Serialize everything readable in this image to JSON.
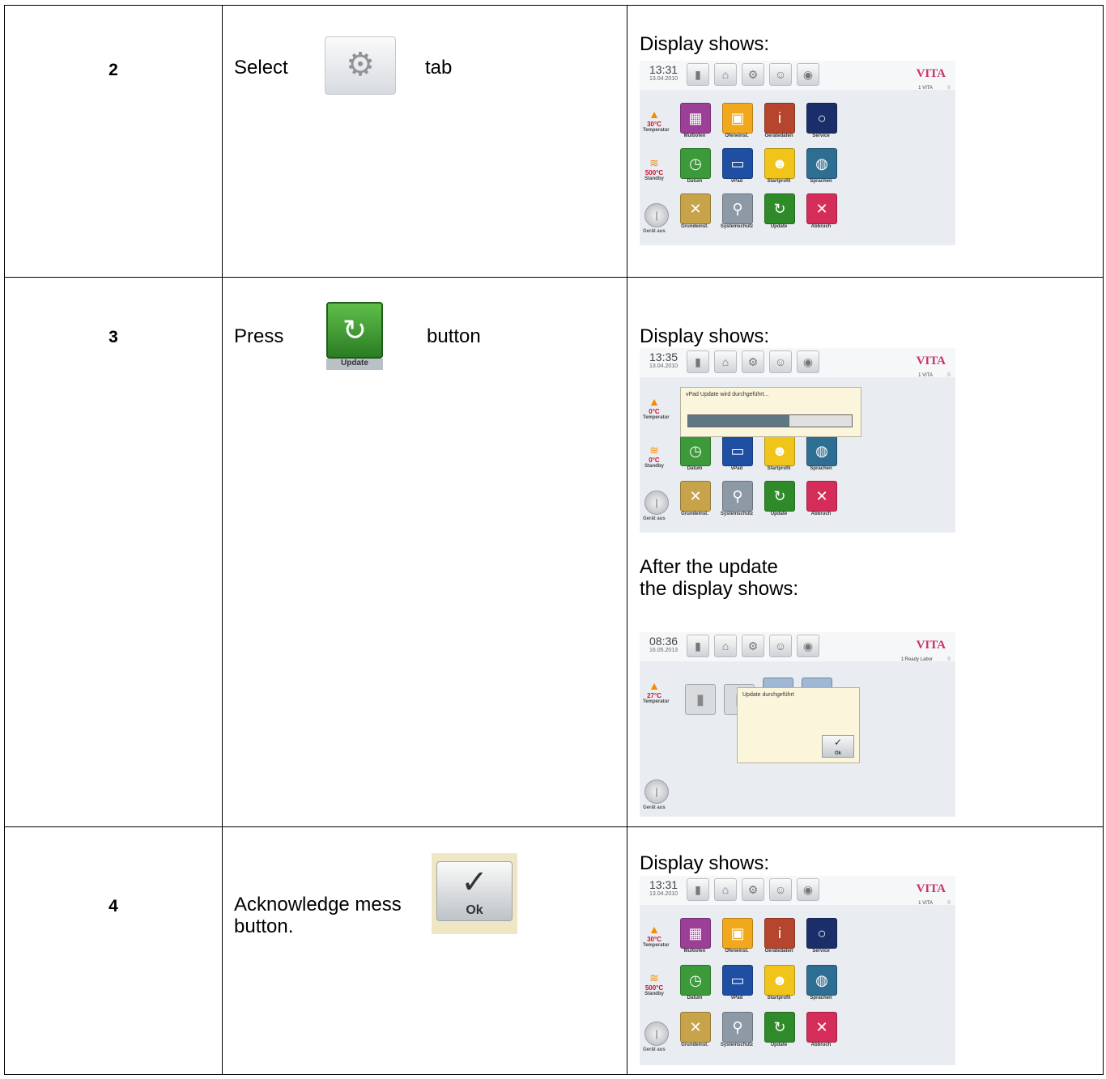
{
  "rows": [
    {
      "step": "2",
      "action_pre": "Select",
      "action_post": "tab",
      "display_label": "Display shows:"
    },
    {
      "step": "3",
      "action_pre": "Press",
      "action_post": "button",
      "button_label": "Update",
      "display_label": "Display shows:",
      "after_text_1": "After the update",
      "after_text_2": "the display shows:"
    },
    {
      "step": "4",
      "action_line1": "Acknowledge mess",
      "action_line2": "button.",
      "ok_label": "Ok",
      "display_label": "Display shows:"
    }
  ],
  "screens": {
    "brand": "VITA",
    "status": "1  VITA",
    "status_ready": "1:Ready     Labor",
    "tiles": [
      "Multiofen",
      "Ofeneinst.",
      "Gerätedaten",
      "Service",
      "Datum",
      "vPad",
      "Startprofil",
      "Sprachen",
      "Grundeinst.",
      "Systemschutz",
      "Update",
      "Abbruch"
    ],
    "temperatur_label": "Temperatur",
    "standby_label": "Standby",
    "power_label": "Gerät aus",
    "screen_a": {
      "time": "13:31",
      "date": "13.04.2010",
      "temp": "30°C",
      "standby": "500°C"
    },
    "screen_b": {
      "time": "13:35",
      "date": "13.04.2010",
      "temp": "0°C",
      "standby": "0°C",
      "dialog": "vPad Update wird durchgeführt...",
      "progress": 0.62
    },
    "screen_c": {
      "time": "08:36",
      "date": "16.05.2013",
      "temp": "27°C",
      "dialog": "Update durchgeführt",
      "ok": "Ok"
    },
    "screen_d": {
      "time": "13:31",
      "date": "13.04.2010",
      "temp": "30°C",
      "standby": "500°C"
    }
  }
}
